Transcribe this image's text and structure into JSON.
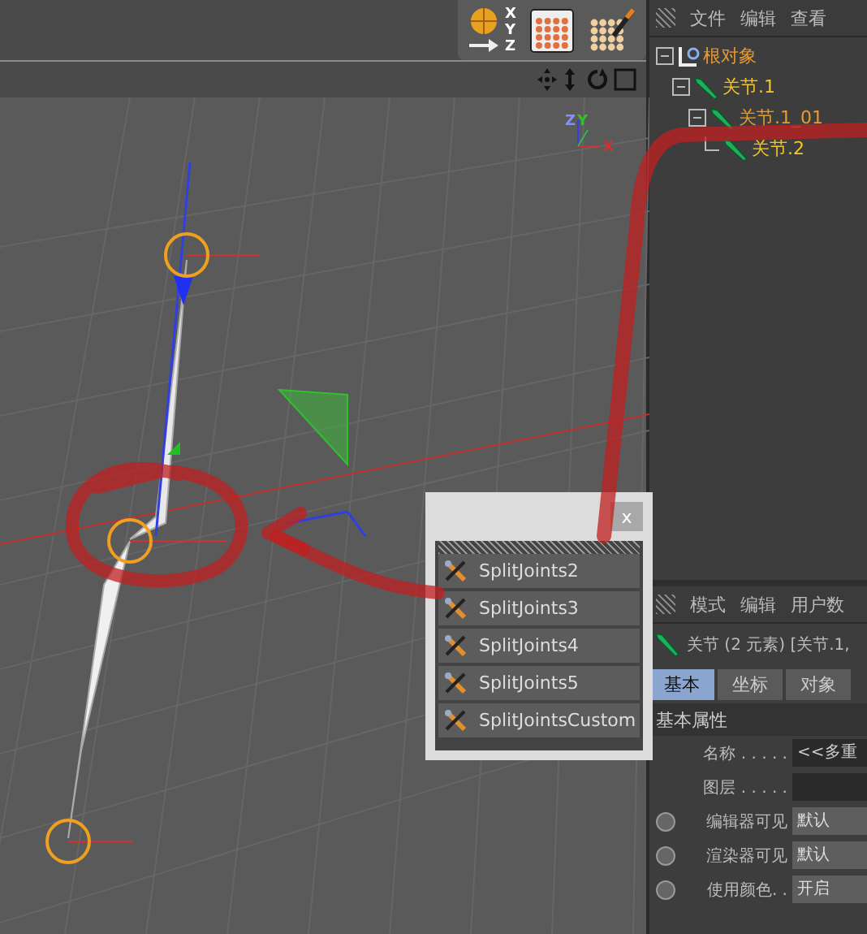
{
  "toolbar": {
    "coord_letters": [
      "X",
      "Y",
      "Z"
    ]
  },
  "viewport": {
    "axis_labels": [
      "Z",
      "Y",
      "X"
    ]
  },
  "object_manager": {
    "menu": [
      "文件",
      "编辑",
      "查看"
    ],
    "tree": [
      {
        "label": "根对象",
        "kind": "null",
        "selected": false,
        "expanded": true,
        "children": [
          {
            "label": "关节.1",
            "kind": "joint",
            "selected": true,
            "expanded": true,
            "children": [
              {
                "label": "关节.1_01",
                "kind": "joint",
                "selected": false,
                "expanded": true,
                "children": [
                  {
                    "label": "关节.2",
                    "kind": "joint",
                    "selected": true
                  }
                ]
              }
            ]
          }
        ]
      }
    ]
  },
  "popup": {
    "close": "x",
    "items": [
      {
        "label": "SplitJoints2"
      },
      {
        "label": "SplitJoints3"
      },
      {
        "label": "SplitJoints4"
      },
      {
        "label": "SplitJoints5"
      },
      {
        "label": "SplitJointsCustom"
      }
    ]
  },
  "attribute_manager": {
    "menu": [
      "模式",
      "编辑",
      "用户数"
    ],
    "title": "关节 (2 元素) [关节.1,",
    "tabs": [
      {
        "label": "基本",
        "selected": true
      },
      {
        "label": "坐标",
        "selected": false
      },
      {
        "label": "对象",
        "selected": false
      }
    ],
    "section": "基本属性",
    "rows": [
      {
        "label": "名称 . . . . .",
        "kind": "text",
        "value": "<<多重"
      },
      {
        "label": "图层 . . . . .",
        "kind": "text"
      },
      {
        "label": "编辑器可见",
        "kind": "dropdown",
        "value": "默认"
      },
      {
        "label": "渲染器可见",
        "kind": "dropdown",
        "value": "默认"
      },
      {
        "label": "使用颜色. .",
        "kind": "dropdown",
        "value": "开启"
      }
    ]
  }
}
